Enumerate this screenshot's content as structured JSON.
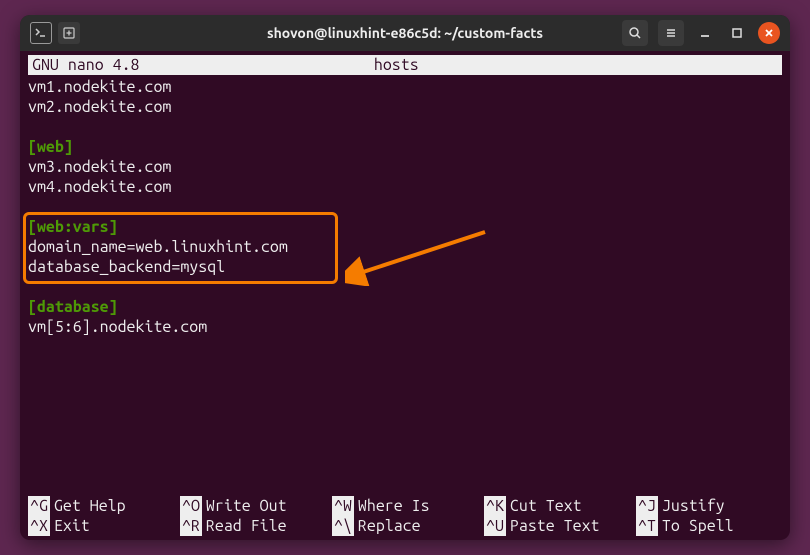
{
  "titlebar": {
    "title": "shovon@linuxhint-e86c5d: ~/custom-facts"
  },
  "nano": {
    "app_name": "  GNU nano 4.8",
    "filename": "hosts"
  },
  "content": {
    "line1": "vm1.nodekite.com",
    "line2": "vm2.nodekite.com",
    "group_web": "[web]",
    "line3": "vm3.nodekite.com",
    "line4": "vm4.nodekite.com",
    "group_webvars": "[web:vars]",
    "line5": "domain_name=web.linuxhint.com",
    "line6": "database_backend=mysql",
    "group_database": "[database]",
    "line7": "vm[5:6].nodekite.com"
  },
  "shortcuts": {
    "r1c1": {
      "key": "^G",
      "label": "Get Help"
    },
    "r1c2": {
      "key": "^O",
      "label": "Write Out"
    },
    "r1c3": {
      "key": "^W",
      "label": "Where Is"
    },
    "r1c4": {
      "key": "^K",
      "label": "Cut Text"
    },
    "r1c5": {
      "key": "^J",
      "label": "Justify"
    },
    "r2c1": {
      "key": "^X",
      "label": "Exit"
    },
    "r2c2": {
      "key": "^R",
      "label": "Read File"
    },
    "r2c3": {
      "key": "^\\",
      "label": "Replace"
    },
    "r2c4": {
      "key": "^U",
      "label": "Paste Text"
    },
    "r2c5": {
      "key": "^T",
      "label": "To Spell"
    }
  }
}
